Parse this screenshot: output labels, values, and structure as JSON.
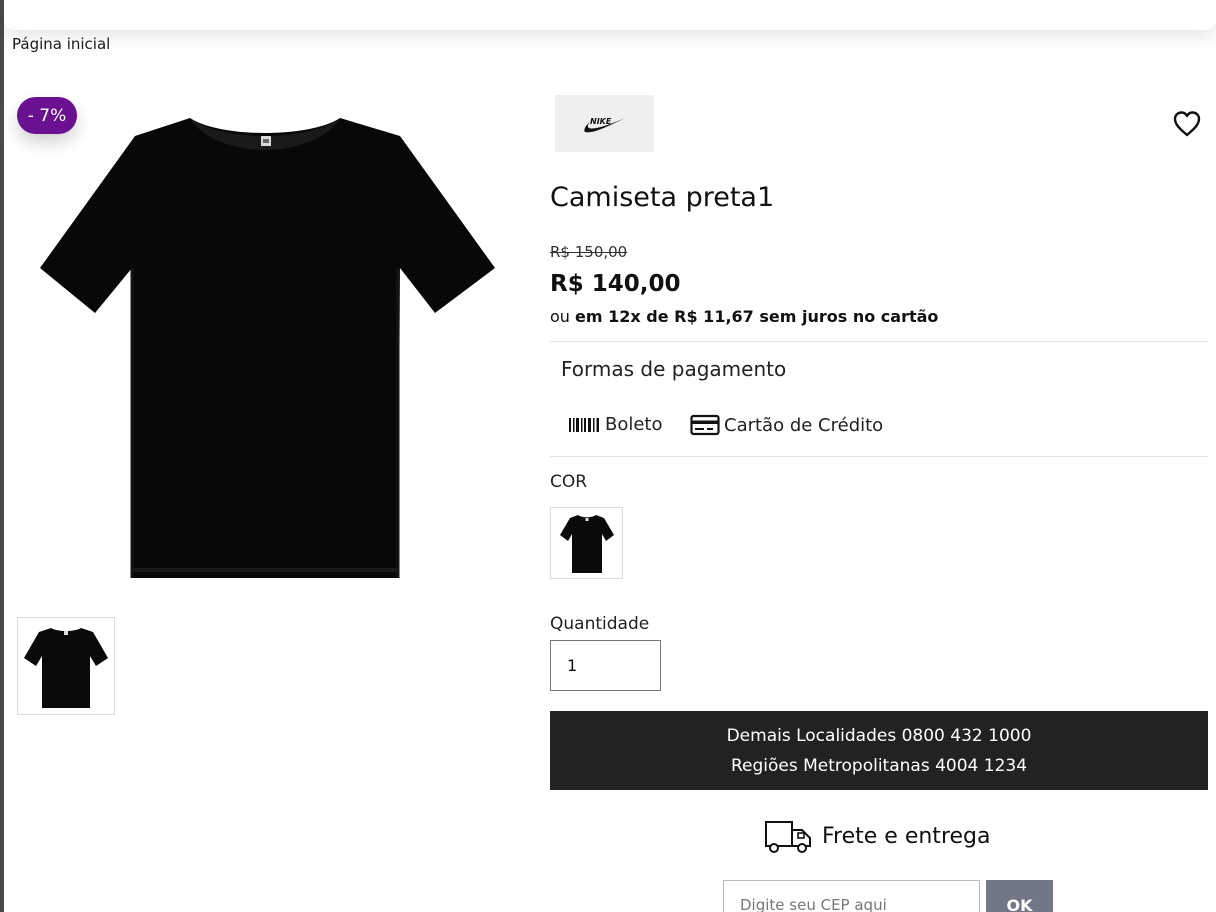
{
  "breadcrumb": {
    "home": "Página inicial"
  },
  "product": {
    "discount_badge": "- 7%",
    "brand": "NIKE",
    "title": "Camiseta preta1",
    "old_price": "R$ 150,00",
    "price": "R$ 140,00",
    "installments_prefix": "ou",
    "installments_bold": "em 12x de R$ 11,67 sem juros no cartão",
    "image_icon": "black-tshirt-image",
    "thumbnail_icon": "black-tshirt-thumbnail"
  },
  "payment": {
    "title": "Formas de pagamento",
    "methods": [
      {
        "label": "Boleto",
        "icon": "barcode-icon"
      },
      {
        "label": "Cartão de Crédito",
        "icon": "credit-card-icon"
      }
    ]
  },
  "color": {
    "label": "COR",
    "swatch_icon": "black-tshirt-swatch"
  },
  "quantity": {
    "label": "Quantidade",
    "value": "1"
  },
  "contact": {
    "line1": "Demais Localidades 0800 432 1000",
    "line2": "Regiões Metropolitanas 4004 1234"
  },
  "shipping": {
    "title": "Frete e entrega",
    "icon": "delivery-truck-icon",
    "cep_placeholder": "Digite seu CEP aqui",
    "ok_label": "OK"
  },
  "colors": {
    "badge": "#6a1191",
    "contact_bar": "#222222",
    "ok_button": "#717785"
  }
}
